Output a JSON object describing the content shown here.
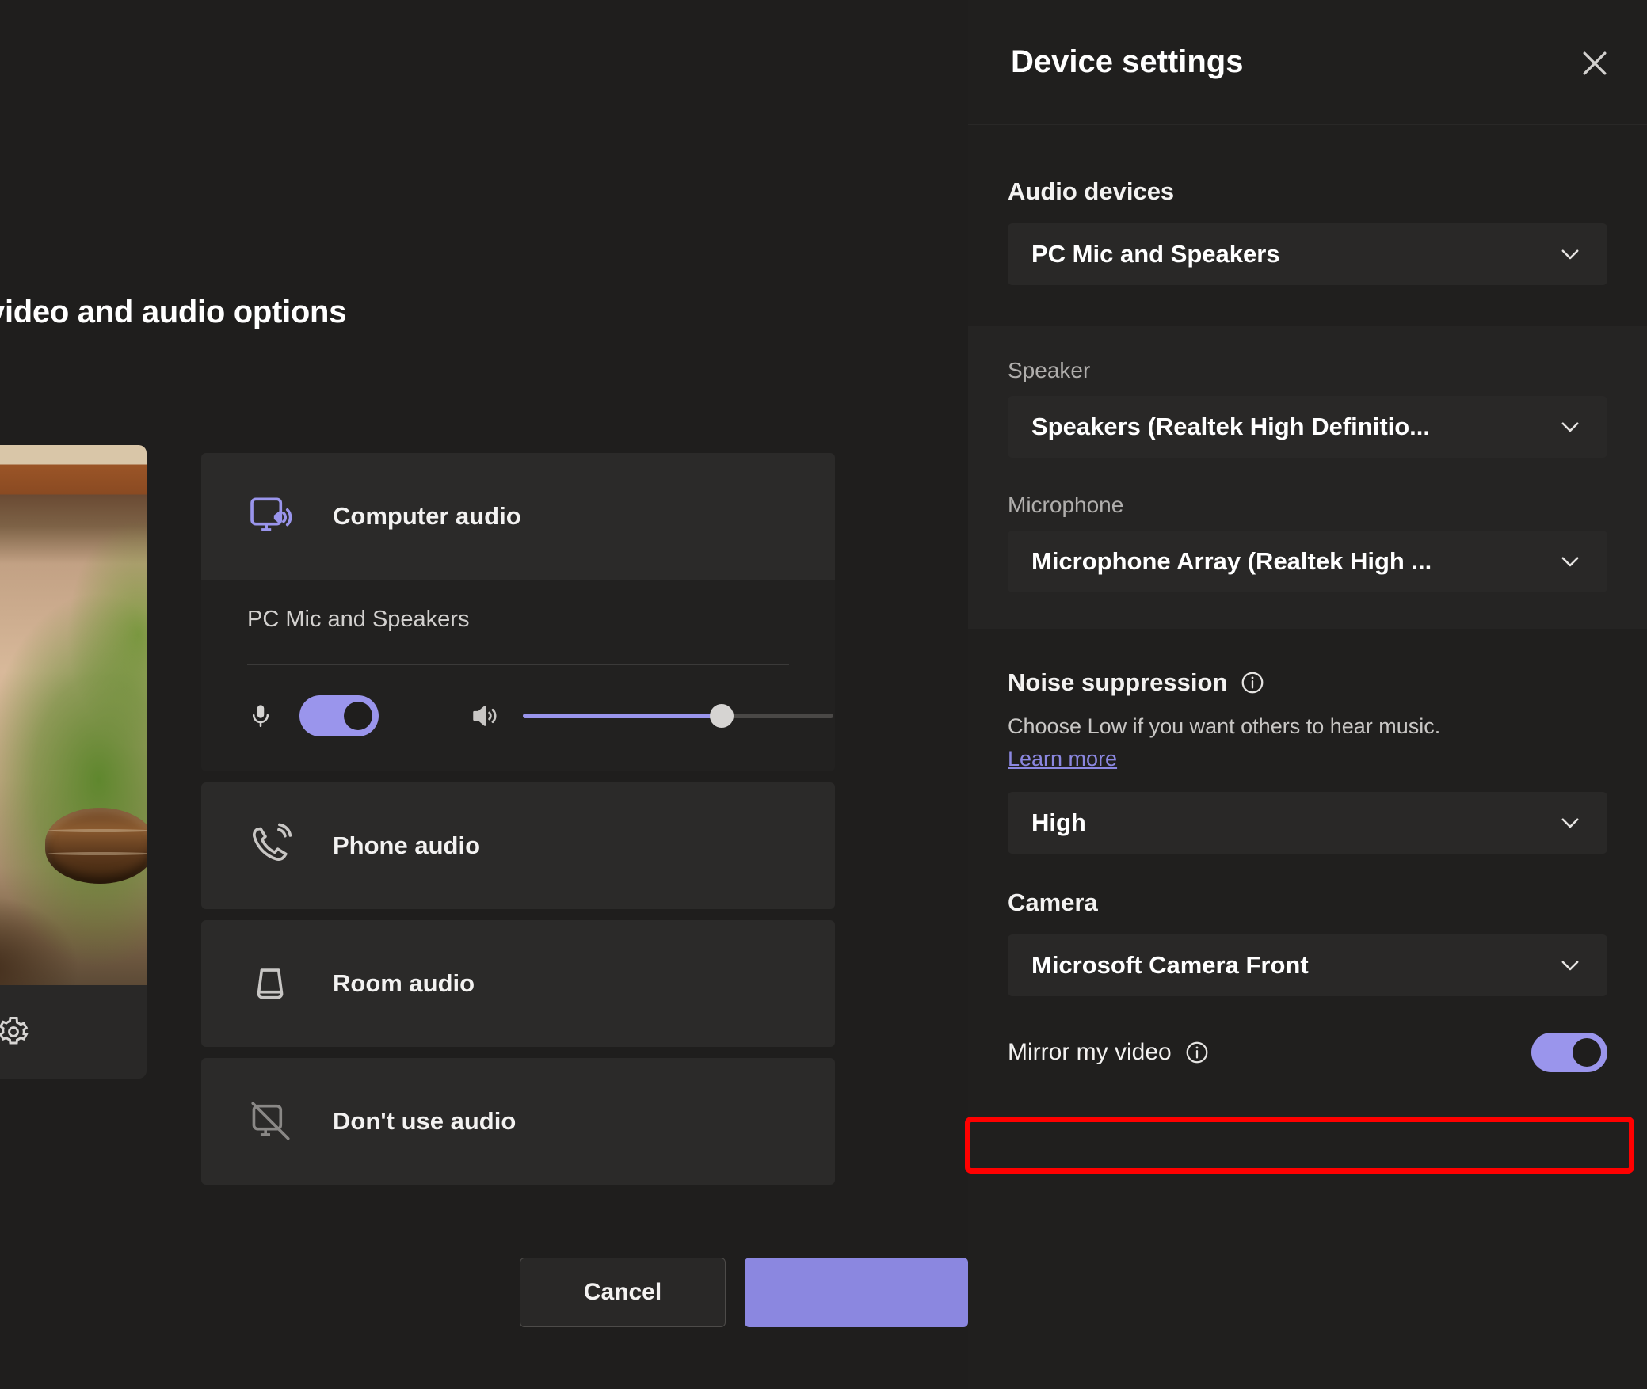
{
  "dialog": {
    "title": "video and audio options",
    "preview": {
      "settings_icon": "gear-icon"
    },
    "audio_options": [
      {
        "id": "computer-audio",
        "label": "Computer audio",
        "icon": "computer-speaker-icon",
        "selected": true
      },
      {
        "id": "phone-audio",
        "label": "Phone audio",
        "icon": "phone-icon",
        "selected": false
      },
      {
        "id": "room-audio",
        "label": "Room audio",
        "icon": "room-speaker-icon",
        "selected": false
      },
      {
        "id": "dont-use-audio",
        "label": "Don't use audio",
        "icon": "no-audio-icon",
        "selected": false
      }
    ],
    "computer_audio": {
      "device_name": "PC Mic and Speakers",
      "mic_icon": "microphone-icon",
      "mic_toggle_on": true,
      "speaker_icon": "speaker-icon",
      "volume_percent": 64
    },
    "buttons": {
      "cancel": "Cancel",
      "join": ""
    }
  },
  "panel": {
    "title": "Device settings",
    "close_icon": "close-icon",
    "audio_devices": {
      "label": "Audio devices",
      "value": "PC Mic and Speakers"
    },
    "speaker": {
      "label": "Speaker",
      "value": "Speakers (Realtek High Definitio..."
    },
    "microphone": {
      "label": "Microphone",
      "value": "Microphone Array (Realtek High ..."
    },
    "noise_suppression": {
      "label": "Noise suppression",
      "info_icon": "info-icon",
      "description": "Choose Low if you want others to hear music.",
      "link": "Learn more",
      "value": "High"
    },
    "camera": {
      "label": "Camera",
      "value": "Microsoft Camera Front"
    },
    "mirror_my_video": {
      "label": "Mirror my video",
      "info_icon": "info-icon",
      "toggle_on": true
    }
  },
  "colors": {
    "accent": "#9a95ec",
    "link": "#8b87e0",
    "panel_bg": "#201f1e",
    "dialog_bg": "#1f1e1d",
    "card_bg": "#2b2a29",
    "field_bg": "#292827",
    "highlight": "#ff0000"
  }
}
